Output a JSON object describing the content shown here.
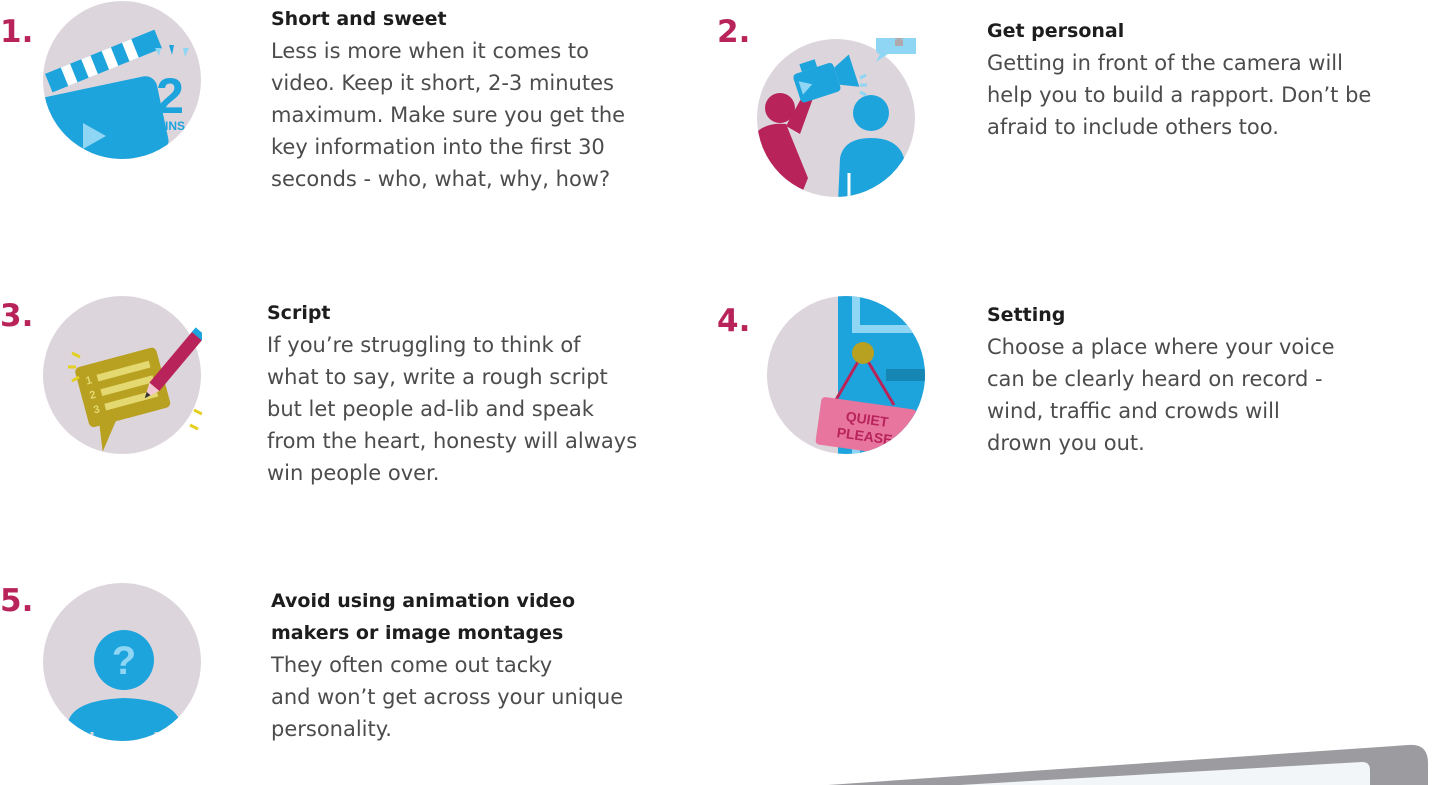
{
  "colors": {
    "number": "#b8245a",
    "circle_bg": "#ddd5dc",
    "accent_blue": "#1ea4dc",
    "accent_magenta": "#b8245a",
    "accent_gold": "#b8a020",
    "laptop_frame": "#9c9ca0"
  },
  "tips": [
    {
      "number": "1.",
      "icon": "video-clapperboard-2-mins-icon",
      "illustration_text": {
        "big": "2",
        "small": "MINS"
      },
      "title_lines": [
        "Short and sweet"
      ],
      "body_lines": [
        "Less is more when it comes to",
        "video. Keep it short, 2-3 minutes",
        "maximum. Make sure you get the",
        "key information into the first 30",
        "seconds - who, what, why, how?"
      ]
    },
    {
      "number": "2.",
      "icon": "person-filming-camera-icon",
      "title_lines": [
        "Get personal"
      ],
      "body_lines": [
        "Getting in front of the camera will",
        "help you to build a rapport. Don’t be",
        "afraid to include others too."
      ]
    },
    {
      "number": "3.",
      "icon": "script-pencil-icon",
      "illustration_text": {
        "list": [
          "1",
          "2",
          "3"
        ]
      },
      "title_lines": [
        "Script"
      ],
      "body_lines": [
        "If you’re struggling to think of",
        "what to say, write a rough script",
        "but let people ad-lib and speak",
        "from the heart, honesty will always",
        "win people over."
      ]
    },
    {
      "number": "4.",
      "icon": "quiet-please-sign-icon",
      "illustration_text": {
        "sign_line1": "QUIET",
        "sign_line2": "PLEASE"
      },
      "title_lines": [
        "Setting"
      ],
      "body_lines": [
        "Choose a place where your voice",
        "can be clearly heard on record -",
        "wind, traffic and crowds will",
        "drown you out."
      ]
    },
    {
      "number": "5.",
      "icon": "anonymous-person-question-icon",
      "illustration_text": {
        "mark": "?"
      },
      "title_lines": [
        "Avoid using animation video",
        "makers or image montages"
      ],
      "body_lines": [
        "They often come out tacky",
        "and won’t get across your unique",
        "personality."
      ]
    }
  ]
}
